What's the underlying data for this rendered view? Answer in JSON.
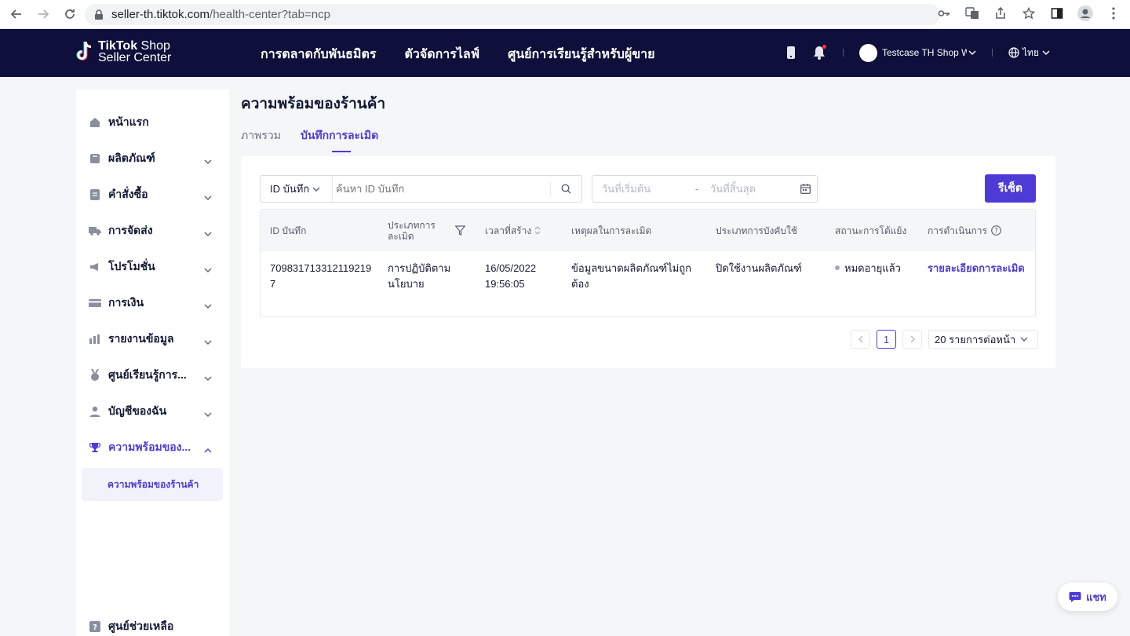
{
  "browser": {
    "url_host": "seller-th.tiktok.com",
    "url_path": "/health-center?tab=ncp"
  },
  "topnav": {
    "logo_line1": "TikTok",
    "logo_line1b": " Shop",
    "logo_line2": "Seller Center",
    "links": [
      "การตลาดกับพันธมิตร",
      "ตัวจัดการไลฟ์",
      "ศูนย์การเรียนรู้สำหรับผู้ขาย"
    ],
    "shop_name": "Testcase TH Shop Wha",
    "language": "ไทย"
  },
  "sidebar": {
    "items": [
      {
        "label": "หน้าแรก",
        "icon": "home-icon"
      },
      {
        "label": "ผลิตภัณฑ์",
        "icon": "product-icon"
      },
      {
        "label": "คำสั่งซื้อ",
        "icon": "order-icon"
      },
      {
        "label": "การจัดส่ง",
        "icon": "truck-icon"
      },
      {
        "label": "โปรโมชั่น",
        "icon": "megaphone-icon"
      },
      {
        "label": "การเงิน",
        "icon": "card-icon"
      },
      {
        "label": "รายงานข้อมูล",
        "icon": "chart-icon"
      },
      {
        "label": "ศูนย์เรียนรู้การ...",
        "icon": "medal-icon"
      },
      {
        "label": "บัญชีของฉัน",
        "icon": "user-icon"
      },
      {
        "label": "ความพร้อมของ...",
        "icon": "trophy-icon"
      }
    ],
    "sub_item": "ความพร้อมของร้านค้า",
    "help": "ศูนย์ช่วยเหลือ"
  },
  "main": {
    "title": "ความพร้อมของร้านค้า",
    "tabs": [
      "ภาพรวม",
      "บันทึกการละเมิด"
    ],
    "search": {
      "select_label": "ID บันทึก",
      "placeholder": "ค้นหา ID บันทึก"
    },
    "date": {
      "start_placeholder": "วันที่เริ่มต้น",
      "dash": "-",
      "end_placeholder": "วันที่สิ้นสุด"
    },
    "reset_label": "รีเซ็ต",
    "table": {
      "headers": [
        "ID บันทึก",
        "ประเภทการละเมิด",
        "เวลาที่สร้าง",
        "เหตุผลในการละเมิด",
        "ประเภทการบังคับใช้",
        "สถานะการโต้แย้ง",
        "การดำเนินการ"
      ],
      "rows": [
        {
          "id": "709831713312119219 7",
          "violation_type": "การปฏิบัติตามนโยบาย",
          "created_date": "16/05/2022",
          "created_time": "19:56:05",
          "reason": "ข้อมูลขนาดผลิตภัณฑ์ไม่ถูกต้อง",
          "enforcement": "ปิดใช้งานผลิตภัณฑ์",
          "appeal_status": "หมดอายุแล้ว",
          "action": "รายละเอียดการละเมิด"
        }
      ]
    },
    "pagination": {
      "current_page": "1",
      "page_size": "20 รายการต่อหน้า"
    }
  },
  "chat_label": "แชท",
  "colors": {
    "nav_bg": "#0e0f3b",
    "accent": "#4e3bd6",
    "page_bg": "#f5f6f8"
  }
}
